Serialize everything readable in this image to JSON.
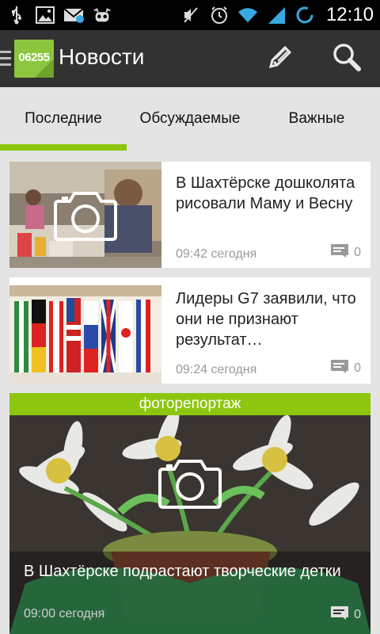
{
  "status_bar": {
    "time": "12:10",
    "icons": [
      "usb-icon",
      "image-icon",
      "mail-icon",
      "android-icon",
      "mute-icon",
      "alarm-icon",
      "wifi-icon",
      "signal-icon",
      "sync-icon"
    ]
  },
  "action_bar": {
    "logo_text": "06255",
    "title": "Новости",
    "icons": [
      "edit-icon",
      "search-icon"
    ]
  },
  "tabs": [
    {
      "label": "Последние",
      "selected": true
    },
    {
      "label": "Обсуждаемые",
      "selected": false
    },
    {
      "label": "Важные",
      "selected": false
    }
  ],
  "news": [
    {
      "title": "В Шахтёрске дошколята рисовали Маму и Весну",
      "time": "09:42 сегодня",
      "comments": "0",
      "thumbnail": "camera-icon"
    },
    {
      "title": "Лидеры G7 заявили, что они не признают результат…",
      "time": "09:24 сегодня",
      "comments": "0",
      "thumbnail": "flags-photo"
    }
  ],
  "photo_report": {
    "label": "фоторепортаж",
    "title": "В Шахтёрске подрастают творческие детки",
    "time": "09:00 сегодня",
    "comments": "0"
  },
  "colors": {
    "accent": "#8cc60f",
    "logo": "#8cc63e",
    "action_bar": "#323232",
    "background": "#e4e4e4"
  }
}
